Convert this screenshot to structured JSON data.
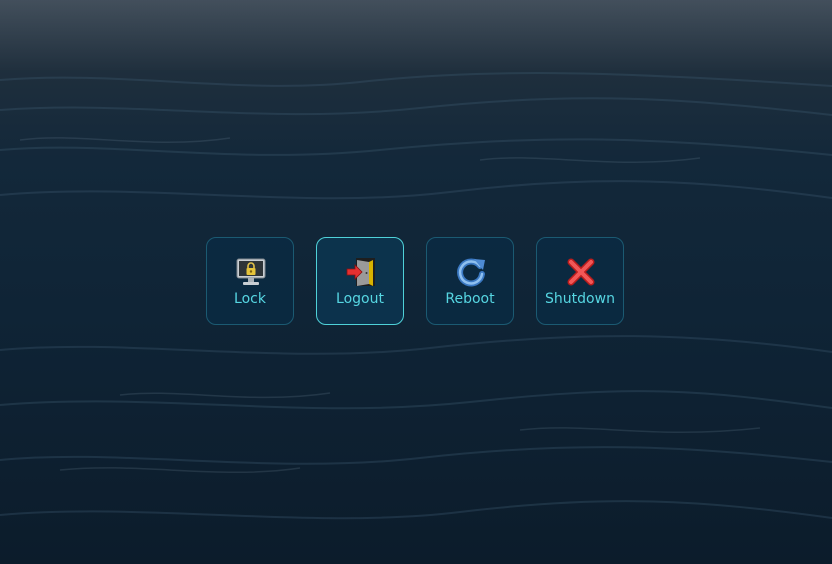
{
  "power_menu": {
    "buttons": [
      {
        "id": "lock",
        "label": "Lock",
        "icon": "lock-monitor-icon"
      },
      {
        "id": "logout",
        "label": "Logout",
        "icon": "logout-door-icon"
      },
      {
        "id": "reboot",
        "label": "Reboot",
        "icon": "reboot-icon"
      },
      {
        "id": "shutdown",
        "label": "Shutdown",
        "icon": "shutdown-icon"
      }
    ],
    "hovered": "logout"
  },
  "colors": {
    "label_text": "#56d6e2",
    "button_border": "#1b5a72",
    "button_border_hover": "#4fd1d8",
    "button_background": "#0a2a42"
  }
}
